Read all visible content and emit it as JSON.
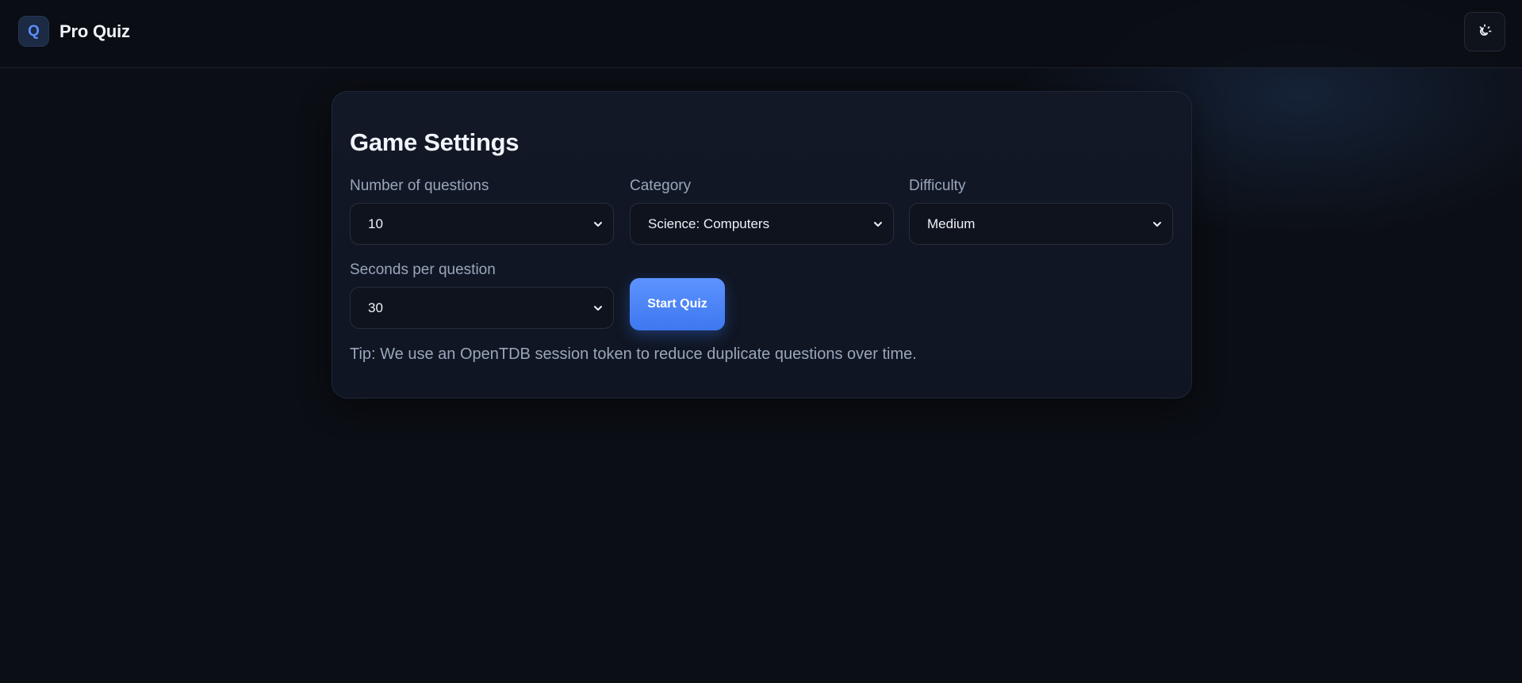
{
  "app": {
    "logo_letter": "Q",
    "title": "Pro Quiz"
  },
  "header": {
    "theme_toggle_icon": "sun-moon-icon"
  },
  "settings": {
    "title": "Game Settings",
    "fields": {
      "num_questions": {
        "label": "Number of questions",
        "value": "10"
      },
      "category": {
        "label": "Category",
        "value": "Science: Computers"
      },
      "difficulty": {
        "label": "Difficulty",
        "value": "Medium"
      },
      "seconds": {
        "label": "Seconds per question",
        "value": "30"
      }
    },
    "start_label": "Start Quiz",
    "tip": "Tip: We use an OpenTDB session token to reduce duplicate questions over time."
  },
  "colors": {
    "background": "#0b0e14",
    "card": "#121826",
    "accent": "#4a84f7",
    "muted_text": "#9aa6ba"
  }
}
